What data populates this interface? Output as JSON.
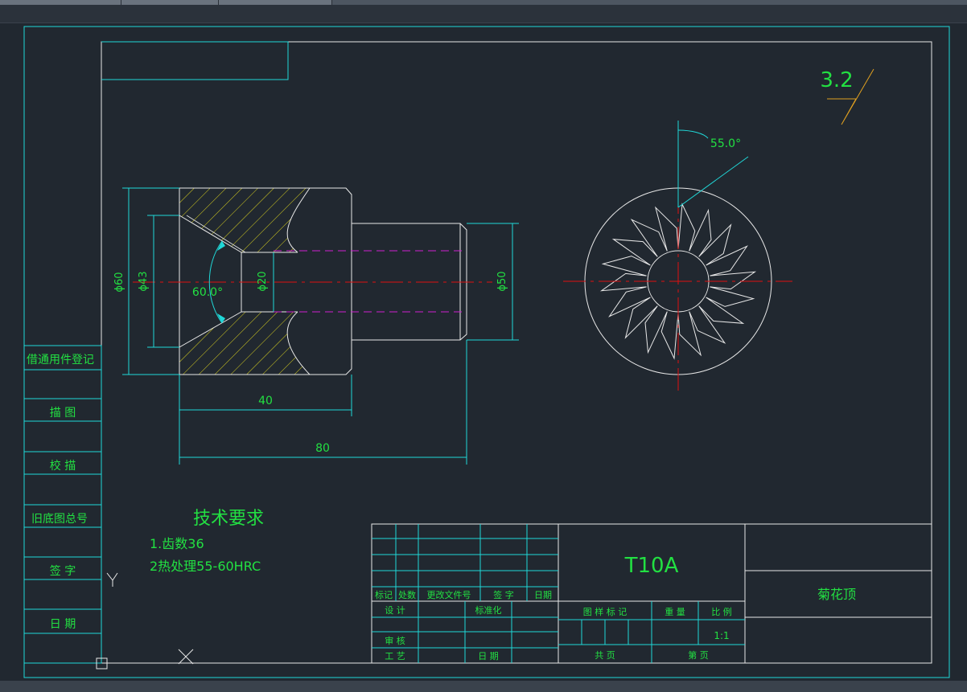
{
  "surface_roughness": "3.2",
  "angles": {
    "taper": "60.0°",
    "teeth": "55.0°"
  },
  "dims": {
    "d60": "ϕ60",
    "d43": "ϕ43",
    "d20": "ϕ20",
    "d50": "ϕ50",
    "len40": "40",
    "len80": "80"
  },
  "tech_requirements": {
    "title": "技术要求",
    "items": [
      "1.齿数36",
      "2热处理55-60HRC"
    ]
  },
  "side_column": [
    "借通用件登记",
    "描  图",
    "校  描",
    "旧底图总号",
    "签  字",
    "日  期"
  ],
  "title_block": {
    "material": "T10A",
    "part_name": "菊花顶",
    "rev_headers": [
      "标记",
      "处数",
      "更改文件号",
      "签 字",
      "日期"
    ],
    "sign_rows": [
      "设 计",
      "标准化",
      "审 核",
      "工 艺",
      "日 期"
    ],
    "info_headers": [
      "图 样 标 记",
      "重 量",
      "比 例"
    ],
    "scale": "1:1",
    "sheet_total": "共      页",
    "sheet_no": "第      页"
  }
}
